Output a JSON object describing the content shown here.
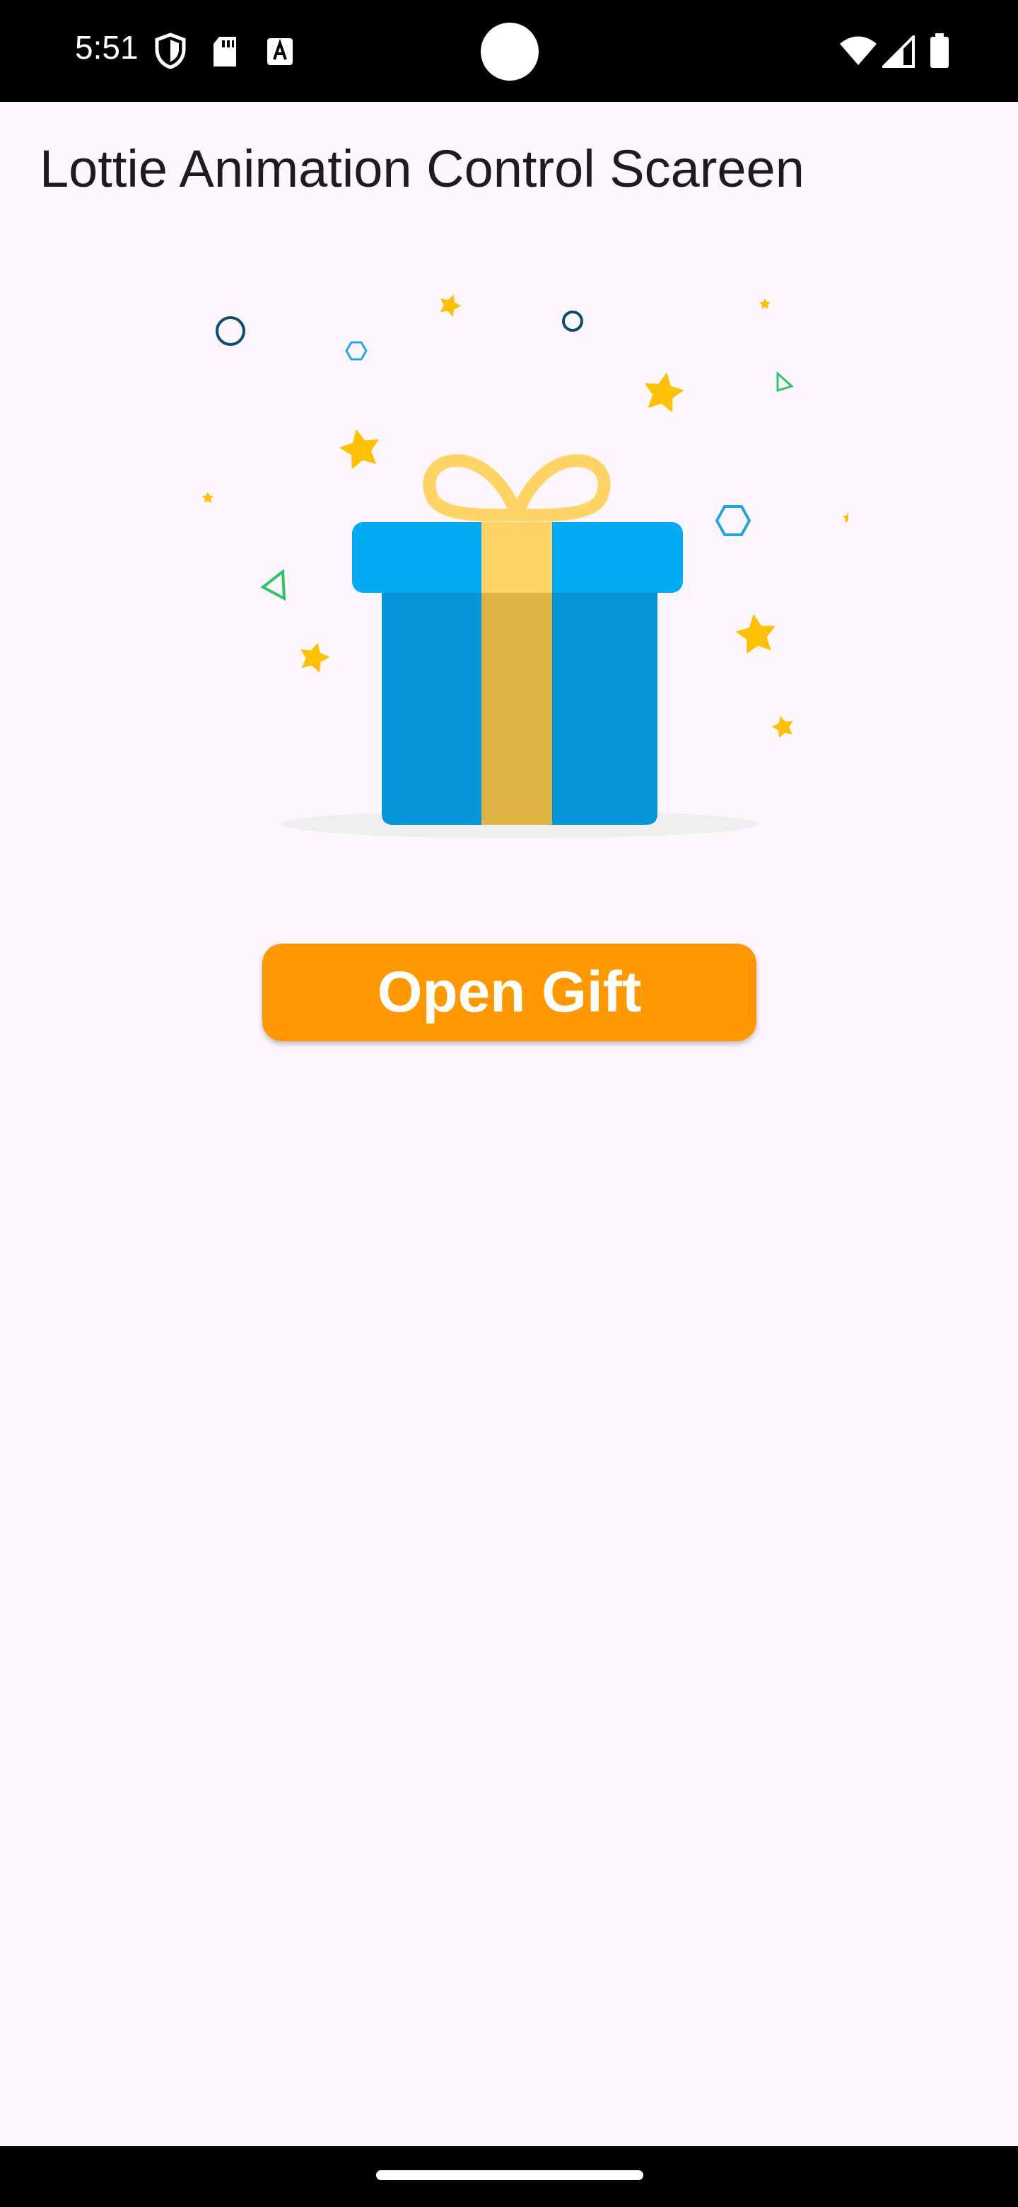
{
  "status_bar": {
    "time": "5:51",
    "left_icons": [
      "shield-icon",
      "sd-card-icon",
      "font-a-icon"
    ],
    "right_icons": [
      "wifi-icon",
      "signal-icon",
      "battery-icon"
    ]
  },
  "page": {
    "title": "Lottie Animation Control Scareen"
  },
  "animation": {
    "name": "gift-box-animation",
    "colors": {
      "box_body": "#0395D8",
      "box_lid": "#03A9F4",
      "ribbon_light": "#FFD467",
      "ribbon_dark": "#DFB447",
      "star": "#FFC107",
      "circle": "#0B4F6C",
      "hexagon": "#29A3DF",
      "triangle": "#2EC46A",
      "shadow": "#EFEFF0"
    }
  },
  "button": {
    "label": "Open Gift",
    "color": "#FF9800"
  }
}
